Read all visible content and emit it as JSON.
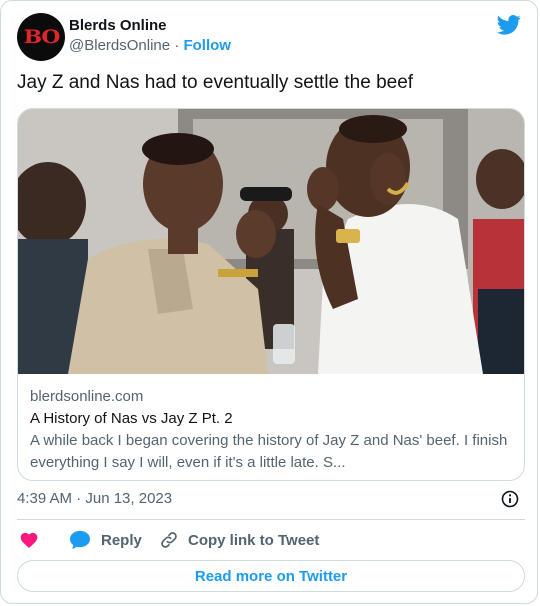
{
  "tweet": {
    "author": {
      "display_name": "Blerds Online",
      "handle": "@BlerdsOnline",
      "separator": "·",
      "follow_label": "Follow",
      "avatar_initials": "BO"
    },
    "text": "Jay Z and Nas had to eventually settle the beef",
    "link_card": {
      "domain": "blerdsonline.com",
      "title": "A History of Nas vs Jay Z Pt. 2",
      "description": "A while back I began covering the history of Jay Z and Nas' beef. I finish everything I say I will, even if it's a little late. S..."
    },
    "timestamp": "4:39 AM · Jun 13, 2023",
    "actions": {
      "like_icon": "heart-icon",
      "reply_label": "Reply",
      "copy_label": "Copy link to Tweet"
    },
    "read_more_label": "Read more on Twitter"
  },
  "colors": {
    "accent": "#1d9bf0",
    "like": "#f91880",
    "secondary_text": "#536471",
    "border": "#cfd9de",
    "logo_red": "#e0262b"
  },
  "icons": [
    "twitter-bird-icon",
    "info-icon",
    "heart-icon",
    "reply-bubble-icon",
    "link-icon"
  ]
}
